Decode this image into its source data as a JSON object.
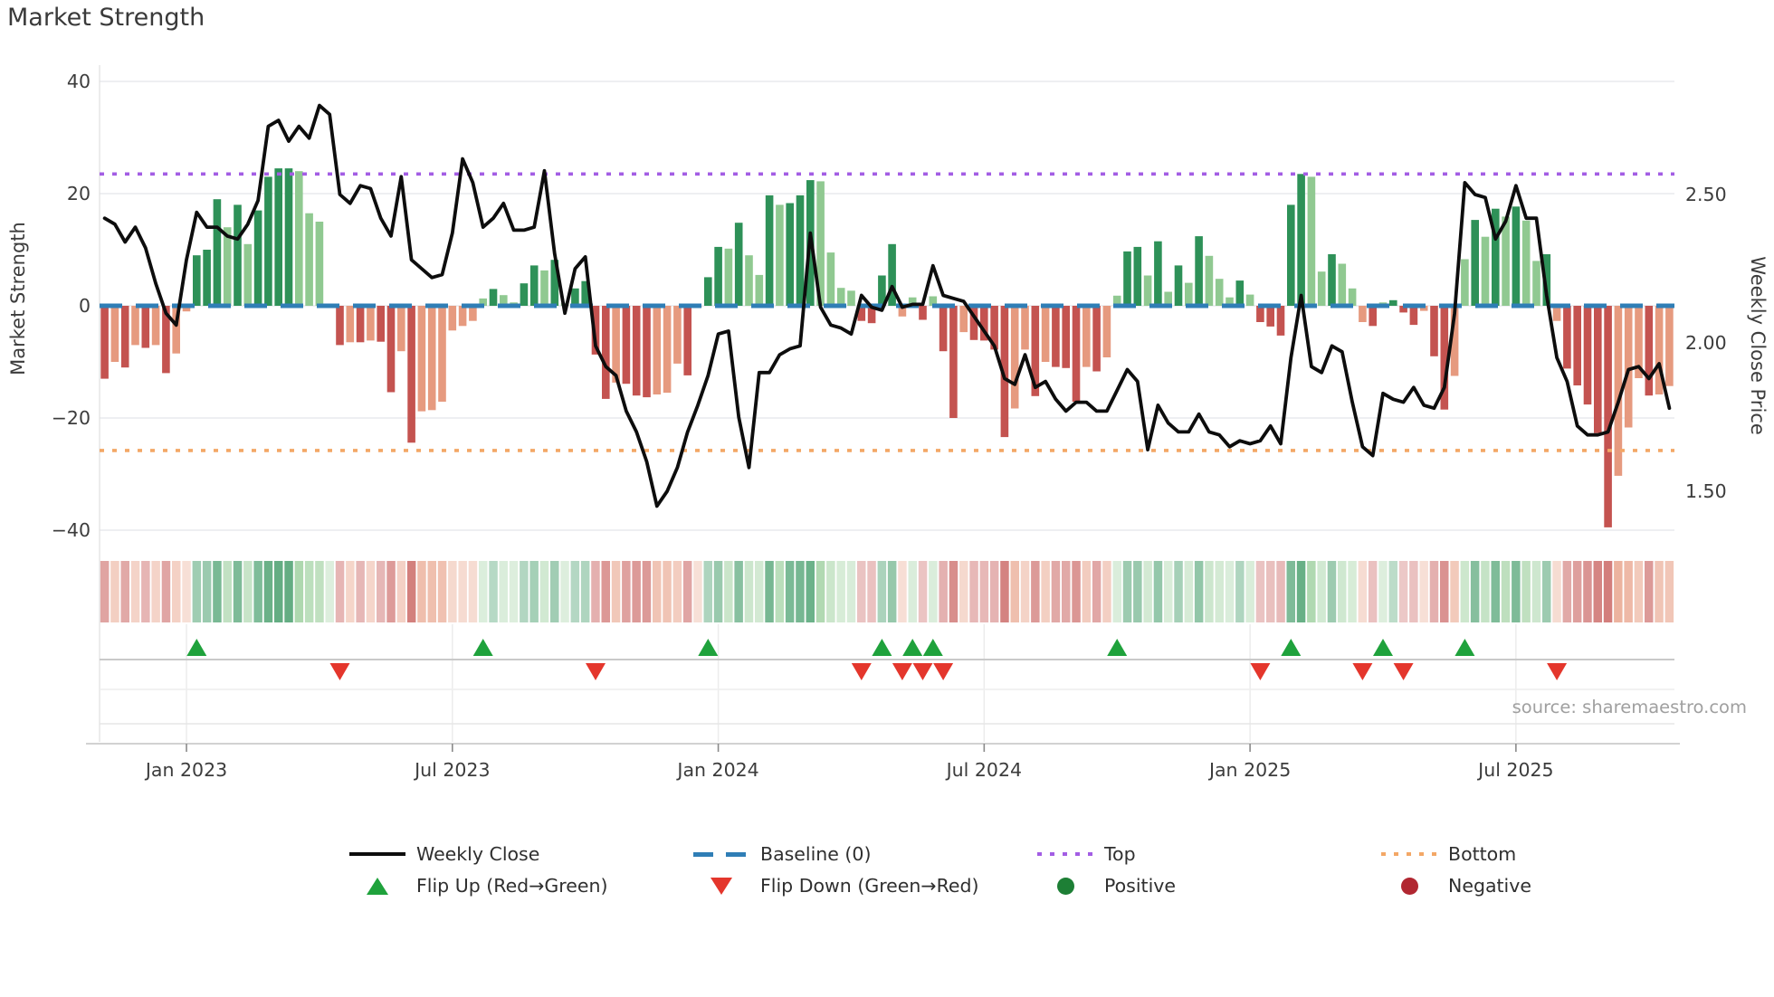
{
  "title": "Market Strength",
  "source": "source: sharemaestro.com",
  "axes": {
    "left": {
      "label": "Market Strength",
      "ticks": [
        "40",
        "20",
        "0",
        "−20",
        "−40"
      ],
      "tick_values": [
        40,
        20,
        0,
        -20,
        -40
      ]
    },
    "right": {
      "label": "Weekly Close Price",
      "ticks": [
        "2.50",
        "2.00",
        "1.50"
      ],
      "tick_values": [
        2.5,
        2.0,
        1.5
      ]
    },
    "x": {
      "ticks": [
        "Jan 2023",
        "Jul 2023",
        "Jan 2024",
        "Jul 2024",
        "Jan 2025",
        "Jul 2025"
      ],
      "tick_weeks": [
        9,
        35,
        61,
        87,
        113,
        139
      ]
    }
  },
  "chart_data": {
    "type": "combo",
    "x_unit": "week",
    "n_weeks": 154,
    "ylim_left": [
      -40,
      43
    ],
    "ylim_right": [
      1.37,
      2.94
    ],
    "baseline": 0,
    "top_line": 23.5,
    "bottom_line": -25.8,
    "series": [
      {
        "name": "Market Strength",
        "type": "bar",
        "axis": "left",
        "values": [
          -13,
          -10,
          -11,
          -7,
          -7.5,
          -7,
          -12,
          -8.5,
          -1,
          9,
          10,
          19,
          14,
          18,
          11,
          17,
          23,
          24.5,
          24.5,
          24,
          16.5,
          15,
          0.3,
          -7,
          -6.5,
          -6.5,
          -6.2,
          -6.4,
          -15.4,
          -8.1,
          -24.4,
          -18.8,
          -18.6,
          -17.1,
          -4.4,
          -3.6,
          -2.7,
          1.3,
          3,
          1.9,
          0.6,
          4,
          7.2,
          6.3,
          8.2,
          0.5,
          3.1,
          4.4,
          -8.7,
          -16.6,
          -13.7,
          -13.9,
          -16,
          -16.3,
          -15.8,
          -15.5,
          -10.3,
          -12.4,
          -0.3,
          5.1,
          10.5,
          10.2,
          14.8,
          9,
          5.5,
          19.7,
          18,
          18.3,
          19.7,
          22.4,
          22.2,
          9.5,
          3.2,
          2.7,
          -2.7,
          -3.1,
          5.4,
          11,
          -1.9,
          1.5,
          -2.5,
          1.7,
          -8.1,
          -20,
          -4.7,
          -6.1,
          -6.2,
          -7.8,
          -23.4,
          -18.3,
          -7.8,
          -16.1,
          -10,
          -10.9,
          -11.1,
          -17.1,
          -10.9,
          -11.7,
          -9.2,
          1.8,
          9.7,
          10.5,
          5.4,
          11.5,
          2.5,
          7.2,
          4.1,
          12.4,
          8.9,
          4.8,
          1.5,
          4.5,
          2,
          -2.9,
          -3.7,
          -5.3,
          18,
          23.5,
          23,
          6.1,
          9.2,
          7.5,
          3.1,
          -2.9,
          -3.6,
          0.6,
          1,
          -1.2,
          -3.4,
          -0.9,
          -9,
          -18.5,
          -12.5,
          8.3,
          15.3,
          12.3,
          17.3,
          15.9,
          17.7,
          15.2,
          8,
          9.2,
          -2.7,
          -11.2,
          -14.2,
          -17.6,
          -22.7,
          -39.5,
          -30.3,
          -21.7,
          -12.9,
          -16,
          -15.8,
          -14.3
        ]
      },
      {
        "name": "Weekly Close",
        "type": "line",
        "axis": "right",
        "values": [
          2.42,
          2.4,
          2.34,
          2.39,
          2.32,
          2.2,
          2.1,
          2.06,
          2.28,
          2.44,
          2.39,
          2.39,
          2.36,
          2.35,
          2.4,
          2.48,
          2.73,
          2.75,
          2.68,
          2.73,
          2.69,
          2.8,
          2.77,
          2.5,
          2.47,
          2.53,
          2.52,
          2.42,
          2.36,
          2.56,
          2.28,
          2.25,
          2.22,
          2.23,
          2.37,
          2.62,
          2.54,
          2.39,
          2.42,
          2.47,
          2.38,
          2.38,
          2.39,
          2.58,
          2.3,
          2.1,
          2.25,
          2.29,
          1.99,
          1.92,
          1.89,
          1.77,
          1.7,
          1.6,
          1.45,
          1.5,
          1.58,
          1.7,
          1.79,
          1.89,
          2.03,
          2.04,
          1.75,
          1.58,
          1.9,
          1.9,
          1.96,
          1.98,
          1.99,
          2.37,
          2.12,
          2.06,
          2.05,
          2.03,
          2.16,
          2.12,
          2.11,
          2.19,
          2.12,
          2.13,
          2.13,
          2.26,
          2.16,
          2.15,
          2.14,
          2.09,
          2.04,
          1.99,
          1.88,
          1.86,
          1.96,
          1.85,
          1.87,
          1.81,
          1.77,
          1.8,
          1.8,
          1.77,
          1.77,
          1.84,
          1.91,
          1.87,
          1.64,
          1.79,
          1.73,
          1.7,
          1.7,
          1.76,
          1.7,
          1.69,
          1.65,
          1.67,
          1.66,
          1.67,
          1.72,
          1.66,
          1.95,
          2.16,
          1.92,
          1.9,
          1.99,
          1.97,
          1.8,
          1.65,
          1.62,
          1.83,
          1.81,
          1.8,
          1.85,
          1.79,
          1.78,
          1.85,
          2.1,
          2.54,
          2.5,
          2.49,
          2.35,
          2.41,
          2.53,
          2.42,
          2.42,
          2.16,
          1.95,
          1.87,
          1.72,
          1.69,
          1.69,
          1.7,
          1.8,
          1.91,
          1.92,
          1.88,
          1.93,
          1.78
        ]
      }
    ],
    "flip_up_weeks": [
      10,
      38,
      60,
      77,
      80,
      82,
      100,
      117,
      126,
      134
    ],
    "flip_down_weeks": [
      24,
      49,
      75,
      79,
      81,
      83,
      114,
      124,
      128,
      143
    ],
    "heatmap": "weekly strength repeated as faded red/green cells"
  },
  "legend": {
    "items": [
      {
        "label": "Weekly Close"
      },
      {
        "label": "Baseline (0)"
      },
      {
        "label": "Top"
      },
      {
        "label": "Bottom"
      },
      {
        "label": "Flip Up (Red→Green)"
      },
      {
        "label": "Flip Down (Green→Red)"
      },
      {
        "label": "Positive"
      },
      {
        "label": "Negative"
      }
    ]
  },
  "colors": {
    "bar_pos_dark": "#2e9158",
    "bar_pos_light": "#90c991",
    "bar_neg_dark": "#c45350",
    "bar_neg_light": "#e69a7f",
    "line": "#0d0d0d",
    "baseline": "#2f7eb6",
    "top": "#a35de4",
    "bottom": "#f3a766",
    "flip_up": "#1fa23c",
    "flip_down": "#e4362c",
    "positive_dot": "#1d7f35",
    "negative_dot": "#b12731",
    "grid": "#e8eaed",
    "axis_line": "#cccccc",
    "tick_text": "#3c3c3c"
  }
}
